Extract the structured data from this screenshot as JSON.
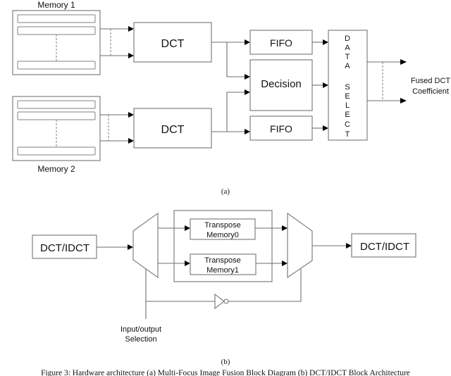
{
  "figure_a": {
    "memory1_label": "Memory 1",
    "memory2_label": "Memory 2",
    "dct_top_label": "DCT",
    "dct_bottom_label": "DCT",
    "fifo_top_label": "FIFO",
    "decision_label": "Decision",
    "fifo_bottom_label": "FIFO",
    "data_select_letters": [
      "D",
      "A",
      "T",
      "A",
      "",
      "S",
      "E",
      "L",
      "E",
      "C",
      "T"
    ],
    "output_label_line1": "Fused DCT",
    "output_label_line2": "Coefficient",
    "sublabel": "(a)"
  },
  "figure_b": {
    "input_block_label": "DCT/IDCT",
    "transpose_memory0_line1": "Transpose",
    "transpose_memory0_line2": "Memory0",
    "transpose_memory1_line1": "Transpose",
    "transpose_memory1_line2": "Memory1",
    "output_block_label": "DCT/IDCT",
    "selection_label_line1": "Input/output",
    "selection_label_line2": "Selection",
    "sublabel": "(b)"
  },
  "caption": "Figure 3: Hardware architecture (a) Multi-Focus Image Fusion Block Diagram (b) DCT/IDCT Block Architecture"
}
